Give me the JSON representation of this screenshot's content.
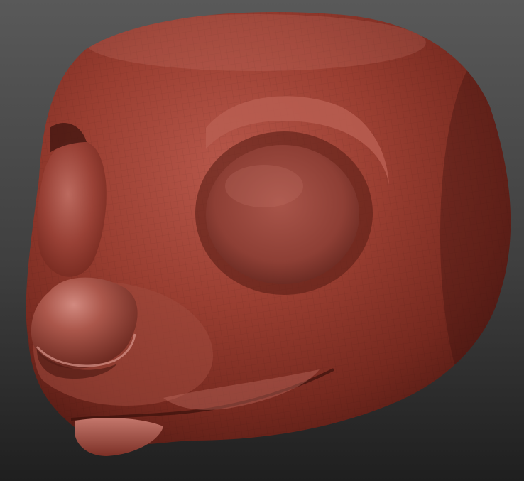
{
  "viewport": {
    "background_top": "#595959",
    "background_bottom": "#1f1f1f"
  },
  "model": {
    "subject": "sculpted-creature-head",
    "material_base": "#9a3e31",
    "material_highlight": "#c7756a",
    "material_shadow": "#5a1e16",
    "wireframe_visible": true
  }
}
